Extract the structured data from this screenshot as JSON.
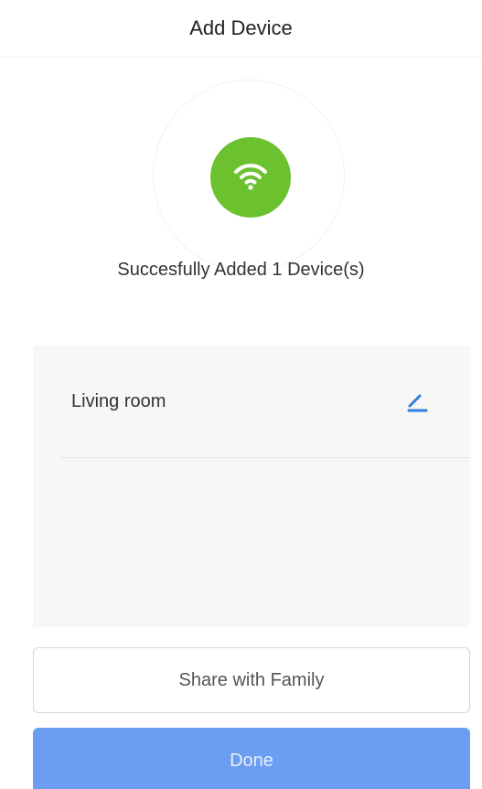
{
  "header": {
    "title": "Add Device"
  },
  "status": {
    "icon": "wifi-icon",
    "badge_color": "#6cc12f",
    "message": "Succesfully Added 1 Device(s)"
  },
  "devices": [
    {
      "name": "Living room",
      "edit_icon": "pencil-edit-icon",
      "edit_icon_color": "#2f7fe0"
    }
  ],
  "buttons": {
    "share_label": "Share with Family",
    "done_label": "Done",
    "done_color": "#6b9ef0"
  }
}
